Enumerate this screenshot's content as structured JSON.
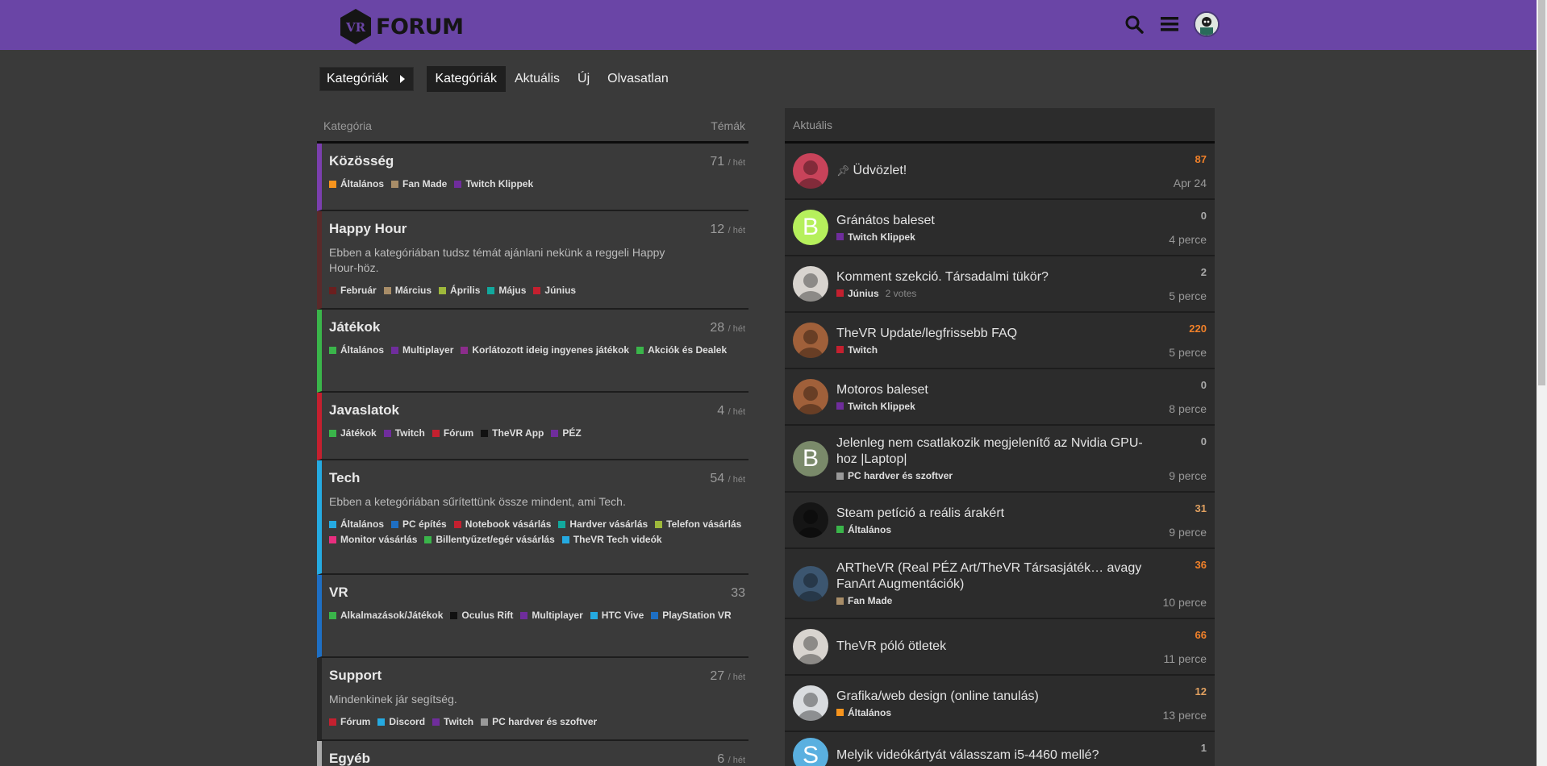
{
  "header": {
    "logo_text": "FORUM",
    "logo_badge": "VR"
  },
  "nav": {
    "dropdown_label": "Kategóriák",
    "tabs": [
      {
        "label": "Kategóriák",
        "active": true
      },
      {
        "label": "Aktuális"
      },
      {
        "label": "Új"
      },
      {
        "label": "Olvasatlan"
      }
    ]
  },
  "categories_table": {
    "col_category": "Kategória",
    "col_topics": "Témák",
    "rows": [
      {
        "title": "Közösség",
        "count": "71",
        "per": "/ hét",
        "color": "#7b3fae",
        "desc": "",
        "subs": [
          {
            "name": "Általános",
            "color": "#f7941d"
          },
          {
            "name": "Fan Made",
            "color": "#a88d68"
          },
          {
            "name": "Twitch Klippek",
            "color": "#6f2d9c"
          }
        ]
      },
      {
        "title": "Happy Hour",
        "count": "12",
        "per": "/ hét",
        "color": "#5a2a2a",
        "desc": "Ebben a kategóriában tudsz témát ajánlani nekünk a reggeli Happy Hour-höz.",
        "subs": [
          {
            "name": "Február",
            "color": "#6b1f1f"
          },
          {
            "name": "Március",
            "color": "#a88d68"
          },
          {
            "name": "Április",
            "color": "#9eb83b"
          },
          {
            "name": "Május",
            "color": "#12a89d"
          },
          {
            "name": "Június",
            "color": "#c4202f"
          }
        ]
      },
      {
        "title": "Játékok",
        "count": "28",
        "per": "/ hét",
        "color": "#3ab54a",
        "desc": "",
        "subs": [
          {
            "name": "Általános",
            "color": "#3ab54a"
          },
          {
            "name": "Multiplayer",
            "color": "#6f2d9c"
          },
          {
            "name": "Korlátozott ideig ingyenes játékok",
            "color": "#8c2d8c"
          },
          {
            "name": "Akciók és Dealek",
            "color": "#3ab54a"
          }
        ]
      },
      {
        "title": "Javaslatok",
        "count": "4",
        "per": "/ hét",
        "color": "#c4202f",
        "desc": "",
        "subs": [
          {
            "name": "Játékok",
            "color": "#3ab54a"
          },
          {
            "name": "Twitch",
            "color": "#6f2d9c"
          },
          {
            "name": "Fórum",
            "color": "#c4202f"
          },
          {
            "name": "TheVR App",
            "color": "#111111"
          },
          {
            "name": "PÉZ",
            "color": "#6f2d9c"
          }
        ]
      },
      {
        "title": "Tech",
        "count": "54",
        "per": "/ hét",
        "color": "#25aae1",
        "desc": "Ebben a ketegóriában sűrítettünk össze mindent, ami Tech.",
        "subs": [
          {
            "name": "Általános",
            "color": "#25aae1"
          },
          {
            "name": "PC építés",
            "color": "#1e6fc4"
          },
          {
            "name": "Notebook vásárlás",
            "color": "#c4202f"
          },
          {
            "name": "Hardver vásárlás",
            "color": "#12a89d"
          },
          {
            "name": "Telefon vásárlás",
            "color": "#9eb83b"
          },
          {
            "name": "Monitor vásárlás",
            "color": "#e92e7f"
          },
          {
            "name": "Billentyűzet/egér vásárlás",
            "color": "#3ab54a"
          },
          {
            "name": "TheVR Tech videók",
            "color": "#25aae1"
          }
        ]
      },
      {
        "title": "VR",
        "count": "33",
        "per": "",
        "color": "#1e6fc4",
        "desc": "",
        "subs": [
          {
            "name": "Alkalmazások/Játékok",
            "color": "#3ab54a"
          },
          {
            "name": "Oculus Rift",
            "color": "#111111"
          },
          {
            "name": "Multiplayer",
            "color": "#6f2d9c"
          },
          {
            "name": "HTC Vive",
            "color": "#25aae1"
          },
          {
            "name": "PlayStation VR",
            "color": "#1e6fc4"
          }
        ]
      },
      {
        "title": "Support",
        "count": "27",
        "per": "/ hét",
        "color": "#262626",
        "desc": "Mindenkinek jár segítség.",
        "subs": [
          {
            "name": "Fórum",
            "color": "#c4202f"
          },
          {
            "name": "Discord",
            "color": "#25aae1"
          },
          {
            "name": "Twitch",
            "color": "#6f2d9c"
          },
          {
            "name": "PC hardver és szoftver",
            "color": "#999999"
          }
        ]
      },
      {
        "title": "Egyéb",
        "count": "6",
        "per": "/ hét",
        "color": "#aaaaaa",
        "desc": "",
        "subs": []
      }
    ]
  },
  "latest": {
    "heading": "Aktuális",
    "topics": [
      {
        "title": "Üdvözlet!",
        "pinned": true,
        "category": "",
        "cat_color": "",
        "votes": "",
        "posts": "87",
        "posts_style": "hot",
        "time": "Apr 24",
        "avatar_letter": "",
        "avatar_color": "#c8435a"
      },
      {
        "title": "Gránátos baleset",
        "category": "Twitch Klippek",
        "cat_color": "#6f2d9c",
        "votes": "",
        "posts": "0",
        "posts_style": "",
        "time": "4 perce",
        "avatar_letter": "B",
        "avatar_color": "#b6f05c"
      },
      {
        "title": "Komment szekció. Társadalmi tükör?",
        "category": "Június",
        "cat_color": "#c4202f",
        "votes": "2 votes",
        "posts": "2",
        "posts_style": "",
        "time": "5 perce",
        "avatar_letter": "",
        "avatar_color": "#d8d4cf"
      },
      {
        "title": "TheVR Update/legfrissebb FAQ",
        "category": "Twitch",
        "cat_color": "#c4202f",
        "votes": "",
        "posts": "220",
        "posts_style": "hot",
        "time": "5 perce",
        "avatar_letter": "",
        "avatar_color": "#a0603a"
      },
      {
        "title": "Motoros baleset",
        "category": "Twitch Klippek",
        "cat_color": "#6f2d9c",
        "votes": "",
        "posts": "0",
        "posts_style": "",
        "time": "8 perce",
        "avatar_letter": "",
        "avatar_color": "#a0603a"
      },
      {
        "title": "Jelenleg nem csatlakozik megjelenítő az Nvidia GPU-hoz |Laptop|",
        "category": "PC hardver és szoftver",
        "cat_color": "#999999",
        "votes": "",
        "posts": "0",
        "posts_style": "",
        "time": "9 perce",
        "avatar_letter": "B",
        "avatar_color": "#7a8a6a"
      },
      {
        "title": "Steam petíció a reális árakért",
        "category": "Általános",
        "cat_color": "#3ab54a",
        "votes": "",
        "posts": "31",
        "posts_style": "warm",
        "time": "9 perce",
        "avatar_letter": "",
        "avatar_color": "#151515"
      },
      {
        "title": "ARTheVR (Real PÉZ Art/TheVR Társasjáték… avagy FanArt Augmentációk)",
        "category": "Fan Made",
        "cat_color": "#a88d68",
        "votes": "",
        "posts": "36",
        "posts_style": "hot",
        "time": "10 perce",
        "avatar_letter": "",
        "avatar_color": "#3c5670"
      },
      {
        "title": "TheVR póló ötletek",
        "category": "",
        "cat_color": "",
        "votes": "",
        "posts": "66",
        "posts_style": "hot",
        "time": "11 perce",
        "avatar_letter": "",
        "avatar_color": "#d8d4cf"
      },
      {
        "title": "Grafika/web design (online tanulás)",
        "category": "Általános",
        "cat_color": "#f7941d",
        "votes": "",
        "posts": "12",
        "posts_style": "warm",
        "time": "13 perce",
        "avatar_letter": "",
        "avatar_color": "#d9dcdf"
      },
      {
        "title": "Melyik videókártyát válasszam i5-4460 mellé?",
        "category": "",
        "cat_color": "",
        "votes": "",
        "posts": "1",
        "posts_style": "",
        "time": "",
        "avatar_letter": "S",
        "avatar_color": "#5ab0e0"
      }
    ]
  }
}
